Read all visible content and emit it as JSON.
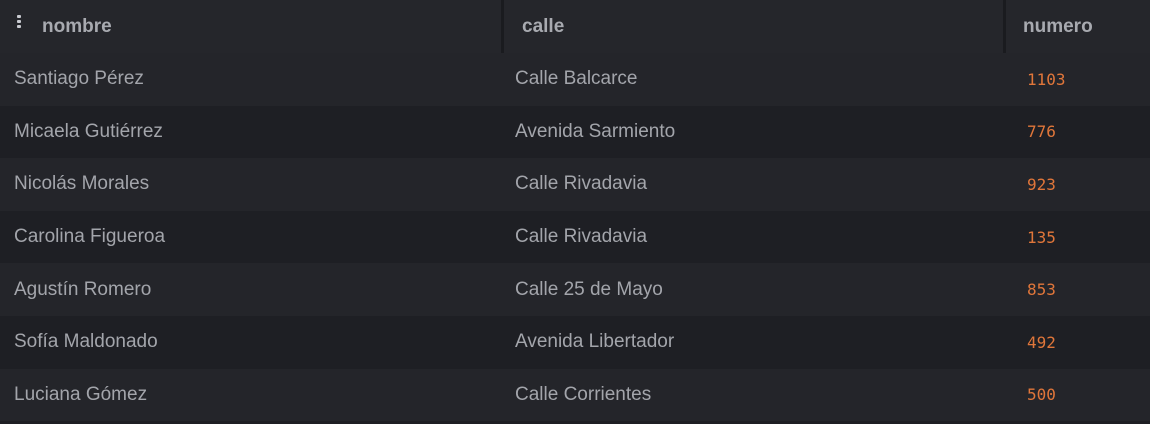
{
  "columns": {
    "nombre": "nombre",
    "calle": "calle",
    "numero": "numero"
  },
  "colors": {
    "background": "#1e1f24",
    "header_background": "#25262b",
    "text": "#a3a5ab",
    "number": "#e0763a"
  },
  "rows": [
    {
      "nombre": "Santiago Pérez",
      "calle": "Calle Balcarce",
      "numero": "1103"
    },
    {
      "nombre": "Micaela Gutiérrez",
      "calle": "Avenida Sarmiento",
      "numero": "776"
    },
    {
      "nombre": "Nicolás Morales",
      "calle": "Calle Rivadavia",
      "numero": "923"
    },
    {
      "nombre": "Carolina Figueroa",
      "calle": "Calle Rivadavia",
      "numero": "135"
    },
    {
      "nombre": "Agustín Romero",
      "calle": "Calle 25 de Mayo",
      "numero": "853"
    },
    {
      "nombre": "Sofía Maldonado",
      "calle": "Avenida Libertador",
      "numero": "492"
    },
    {
      "nombre": "Luciana Gómez",
      "calle": "Calle Corrientes",
      "numero": "500"
    }
  ]
}
